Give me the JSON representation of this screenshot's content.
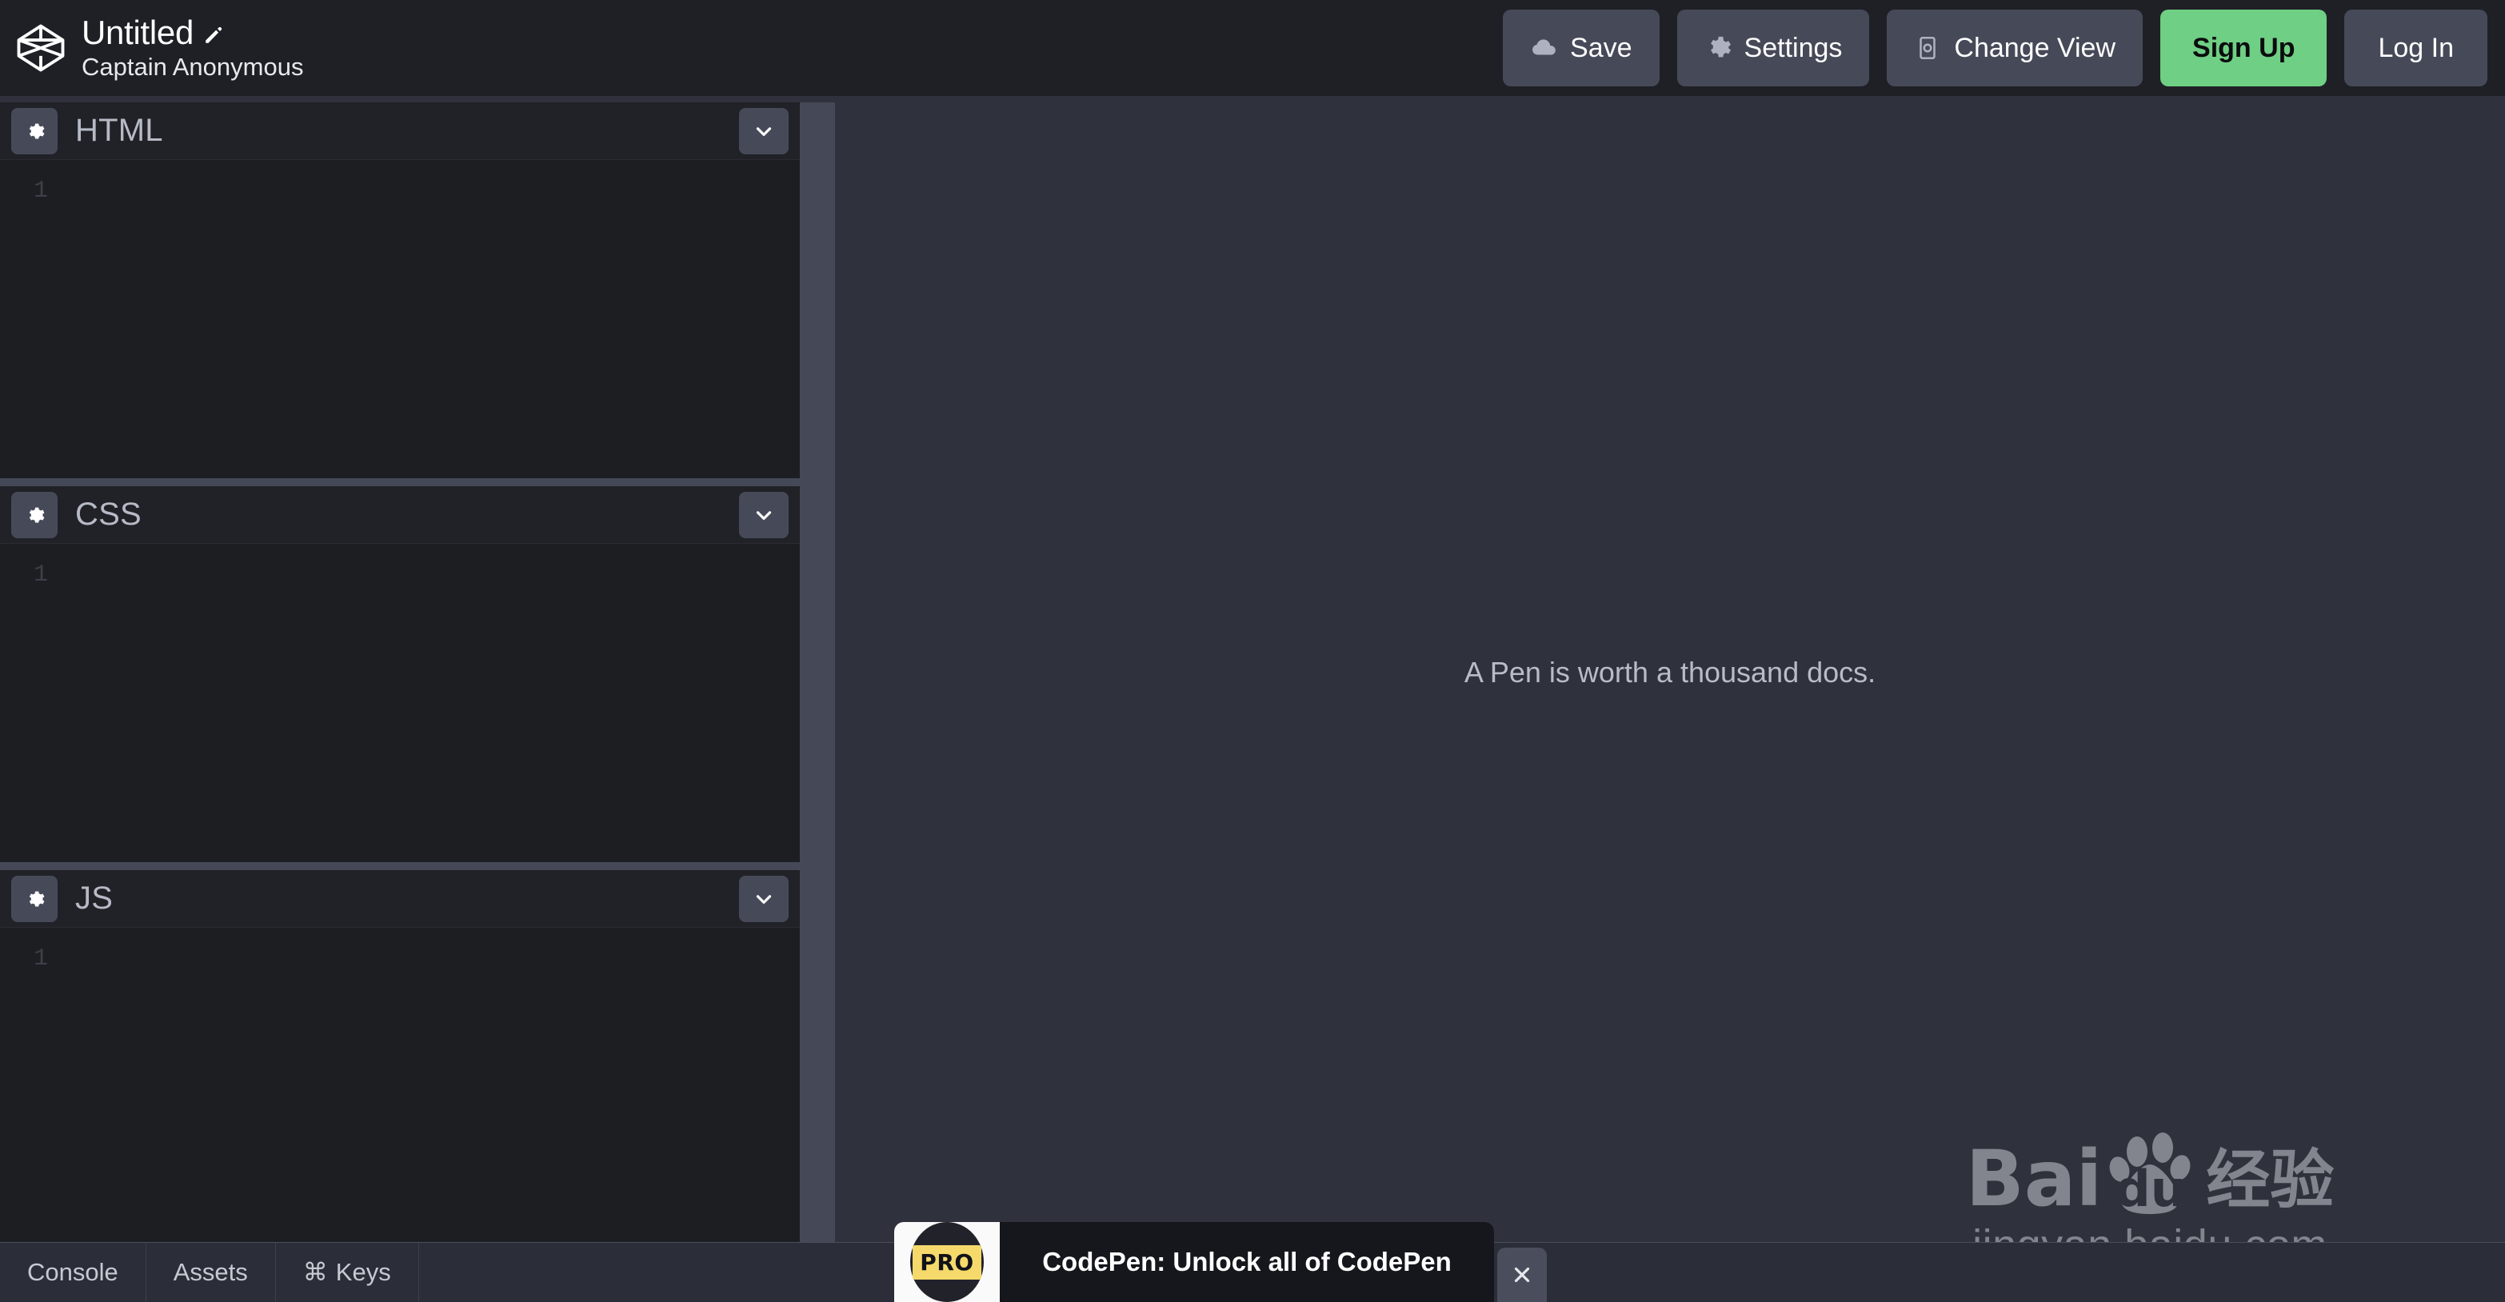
{
  "header": {
    "logo_icon": "codepen-logo-icon",
    "pen_title": "Untitled",
    "edit_icon": "pencil-icon",
    "author": "Captain Anonymous",
    "actions": [
      {
        "label": "Save",
        "icon": "cloud-icon",
        "style": "default"
      },
      {
        "label": "Settings",
        "icon": "gear-icon",
        "style": "default"
      },
      {
        "label": "Change View",
        "icon": "screen-icon",
        "style": "default"
      },
      {
        "label": "Sign Up",
        "icon": "",
        "style": "primary"
      },
      {
        "label": "Log In",
        "icon": "",
        "style": "default"
      }
    ]
  },
  "editors": [
    {
      "label": "HTML",
      "settings_icon": "gear-icon",
      "collapse_icon": "chevron-down-icon",
      "line_number": "1",
      "value": ""
    },
    {
      "label": "CSS",
      "settings_icon": "gear-icon",
      "collapse_icon": "chevron-down-icon",
      "line_number": "1",
      "value": ""
    },
    {
      "label": "JS",
      "settings_icon": "gear-icon",
      "collapse_icon": "chevron-down-icon",
      "line_number": "1",
      "value": ""
    }
  ],
  "preview": {
    "empty_message": "A Pen is worth a thousand docs."
  },
  "watermark": {
    "brand": "Bai",
    "brand_suffix": "du",
    "paw_icon": "paw-print-icon",
    "chinese": "经验",
    "url": "jingyan.baidu.com"
  },
  "bottom_bar": {
    "items": [
      {
        "label": "Console",
        "icon": ""
      },
      {
        "label": "Assets",
        "icon": ""
      },
      {
        "label": "Keys",
        "icon": "⌘"
      }
    ]
  },
  "notification": {
    "badge_text": "PRO",
    "message": "CodePen: Unlock all of CodePen",
    "close_icon": "close-icon"
  },
  "colors": {
    "topbar_bg": "#1f2026",
    "editor_bg": "#1d1e22",
    "panel_head_bg": "#212227",
    "button_bg": "#464a58",
    "splitter": "#454957",
    "preview_bg": "#2f313c",
    "bottom_bar_bg": "#2b2e38",
    "accent_green": "#6fcf84",
    "notif_bg": "#16171c",
    "pro_yellow": "#f5d96b",
    "text_muted": "#b6bac6"
  }
}
